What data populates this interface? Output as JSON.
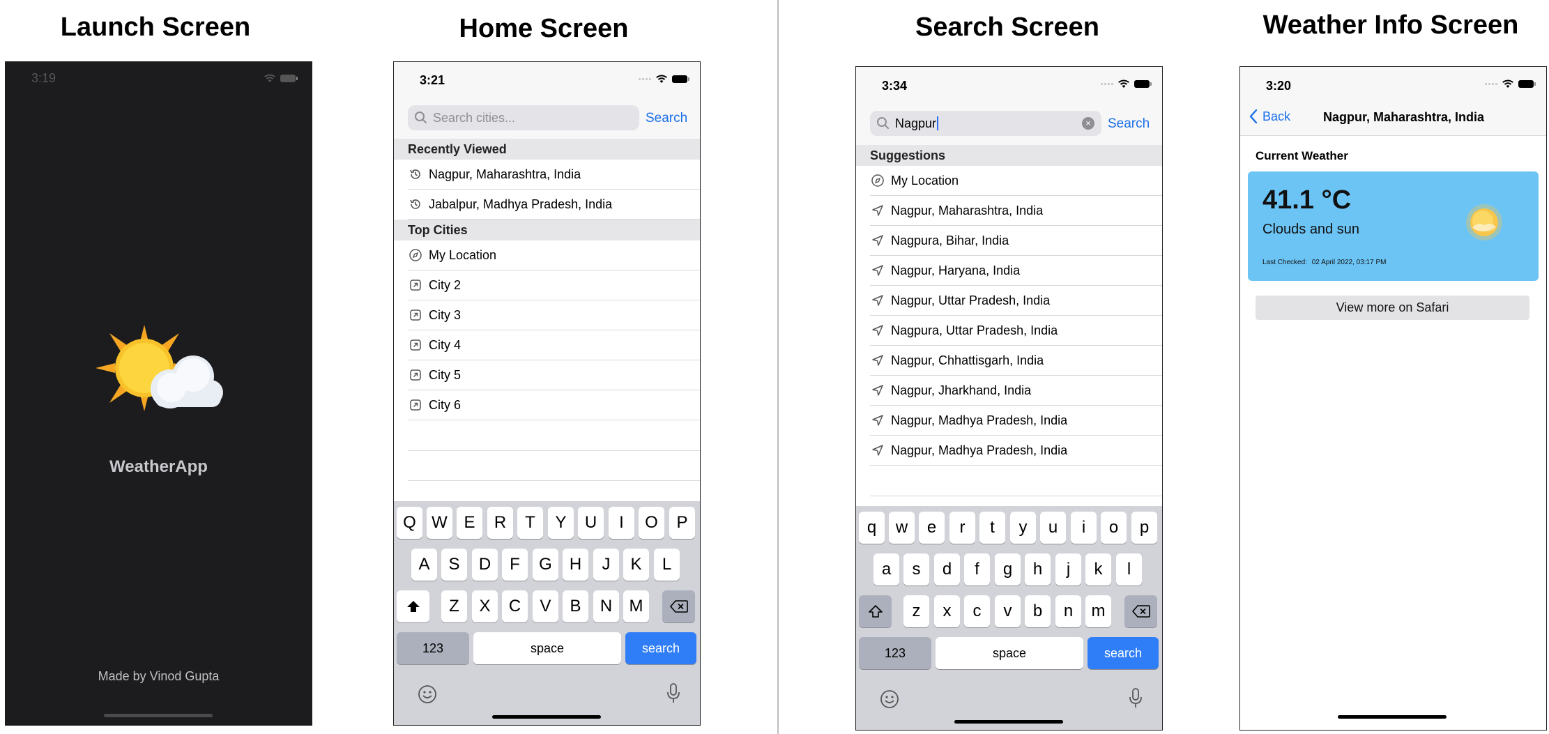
{
  "headings": {
    "launch": "Launch Screen",
    "home": "Home Screen",
    "search": "Search Screen",
    "weather": "Weather Info Screen"
  },
  "launch": {
    "time": "3:19",
    "app_name": "WeatherApp",
    "credit": "Made by Vinod Gupta",
    "logo_icon": "sun-behind-cloud-icon"
  },
  "home": {
    "time": "3:21",
    "search_placeholder": "Search cities...",
    "search_button": "Search",
    "recent_header": "Recently Viewed",
    "recent": [
      "Nagpur, Maharashtra, India",
      "Jabalpur, Madhya Pradesh, India"
    ],
    "top_header": "Top Cities",
    "top": [
      "My Location",
      "City 2",
      "City 3",
      "City 4",
      "City 5",
      "City 6"
    ],
    "keyboard": {
      "row1": [
        "Q",
        "W",
        "E",
        "R",
        "T",
        "Y",
        "U",
        "I",
        "O",
        "P"
      ],
      "row2": [
        "A",
        "S",
        "D",
        "F",
        "G",
        "H",
        "J",
        "K",
        "L"
      ],
      "row3": [
        "Z",
        "X",
        "C",
        "V",
        "B",
        "N",
        "M"
      ],
      "numbers": "123",
      "space": "space",
      "action": "search"
    }
  },
  "search": {
    "time": "3:34",
    "query": "Nagpur",
    "search_button": "Search",
    "suggestions_header": "Suggestions",
    "suggestions": [
      "My Location",
      "Nagpur, Maharashtra, India",
      "Nagpura, Bihar, India",
      "Nagpur, Haryana, India",
      "Nagpur, Uttar Pradesh, India",
      "Nagpura, Uttar Pradesh, India",
      "Nagpur, Chhattisgarh, India",
      "Nagpur, Jharkhand, India",
      "Nagpur, Madhya Pradesh, India",
      "Nagpur, Madhya Pradesh, India"
    ],
    "keyboard": {
      "row1": [
        "q",
        "w",
        "e",
        "r",
        "t",
        "y",
        "u",
        "i",
        "o",
        "p"
      ],
      "row2": [
        "a",
        "s",
        "d",
        "f",
        "g",
        "h",
        "j",
        "k",
        "l"
      ],
      "row3": [
        "z",
        "x",
        "c",
        "v",
        "b",
        "n",
        "m"
      ],
      "numbers": "123",
      "space": "space",
      "action": "search"
    }
  },
  "weather": {
    "time": "3:20",
    "back": "Back",
    "title": "Nagpur, Maharashtra, India",
    "section": "Current Weather",
    "temperature": "41.1 °C",
    "condition": "Clouds and sun",
    "last_checked_label": "Last Checked:",
    "last_checked_value": "02 April 2022, 03:17 PM",
    "safari_button": "View more on Safari",
    "card_color": "#6cc4f5",
    "condition_icon": "sun-icon"
  },
  "colors": {
    "accent": "#1a6fe8",
    "launch_bg": "#1c1c1e",
    "keyboard_bg": "#d1d3d9",
    "search_key": "#2f7ef7"
  }
}
